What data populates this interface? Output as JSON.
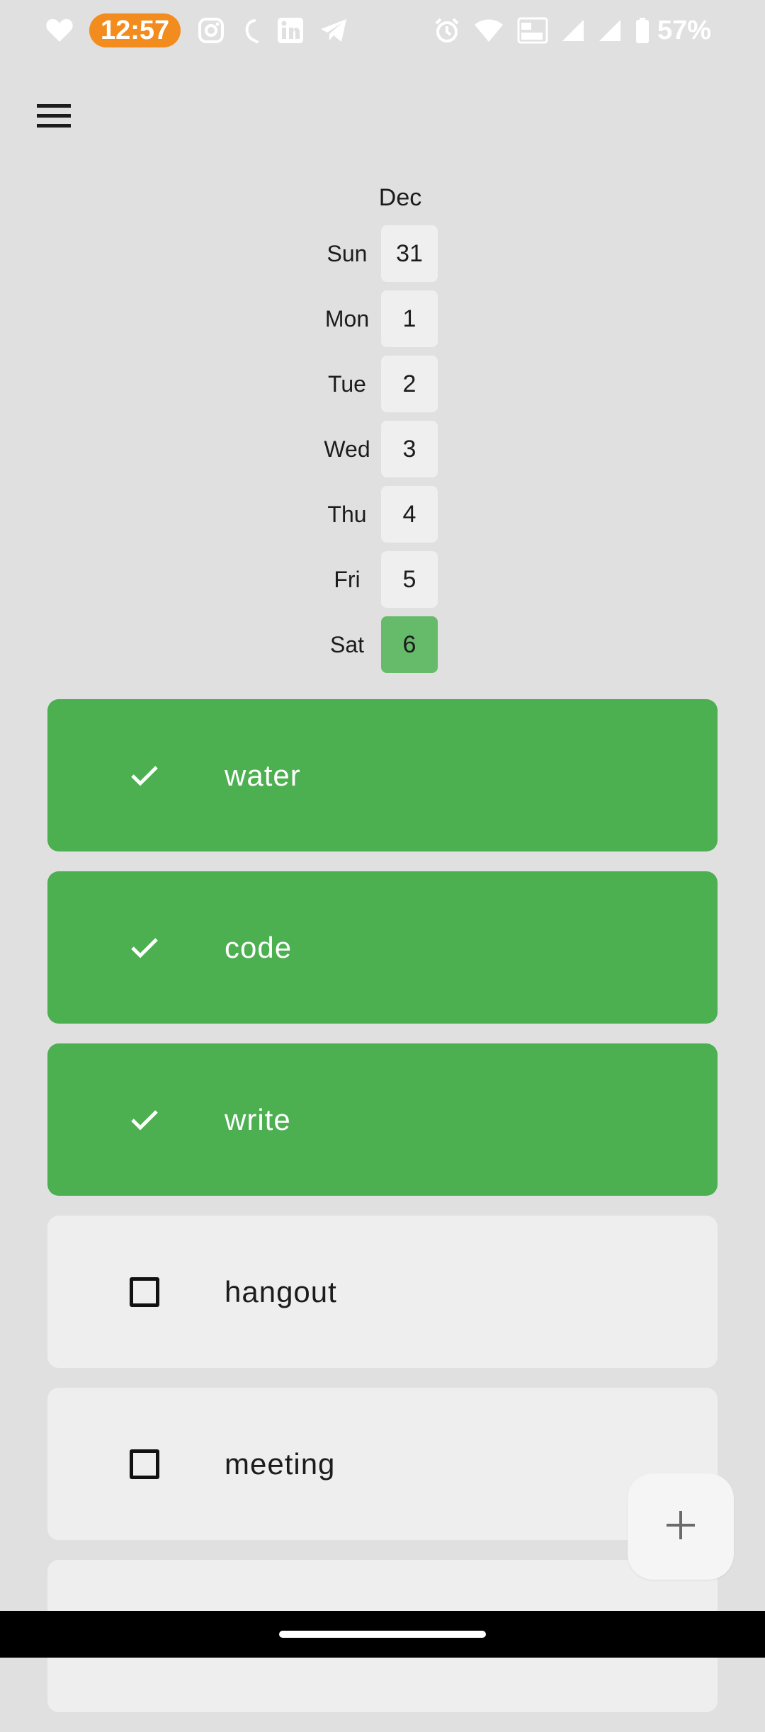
{
  "status_bar": {
    "time": "12:57",
    "battery": "57%",
    "left_icons": [
      "heart-icon",
      "instagram-icon",
      "moon-icon",
      "linkedin-icon",
      "telegram-icon"
    ],
    "right_icons": [
      "alarm-icon",
      "wifi-icon",
      "volte-icon",
      "signal-icon",
      "signal-icon",
      "battery-icon"
    ]
  },
  "calendar": {
    "month": "Dec",
    "days": [
      {
        "name": "Sun",
        "date": "31"
      },
      {
        "name": "Mon",
        "date": "1"
      },
      {
        "name": "Tue",
        "date": "2"
      },
      {
        "name": "Wed",
        "date": "3"
      },
      {
        "name": "Thu",
        "date": "4"
      },
      {
        "name": "Fri",
        "date": "5"
      },
      {
        "name": "Sat",
        "date": "6"
      }
    ],
    "selected_index": 6
  },
  "habits": [
    {
      "label": "water",
      "done": true
    },
    {
      "label": "code",
      "done": true
    },
    {
      "label": "write",
      "done": true
    },
    {
      "label": "hangout",
      "done": false
    },
    {
      "label": "meeting",
      "done": false
    }
  ],
  "fab": {
    "icon": "plus-icon"
  },
  "colors": {
    "background": "#e0e0e0",
    "done": "#4caf50",
    "selected_day": "#66bb6a",
    "card": "#eeeeee",
    "time_pill": "#f28c1e"
  }
}
